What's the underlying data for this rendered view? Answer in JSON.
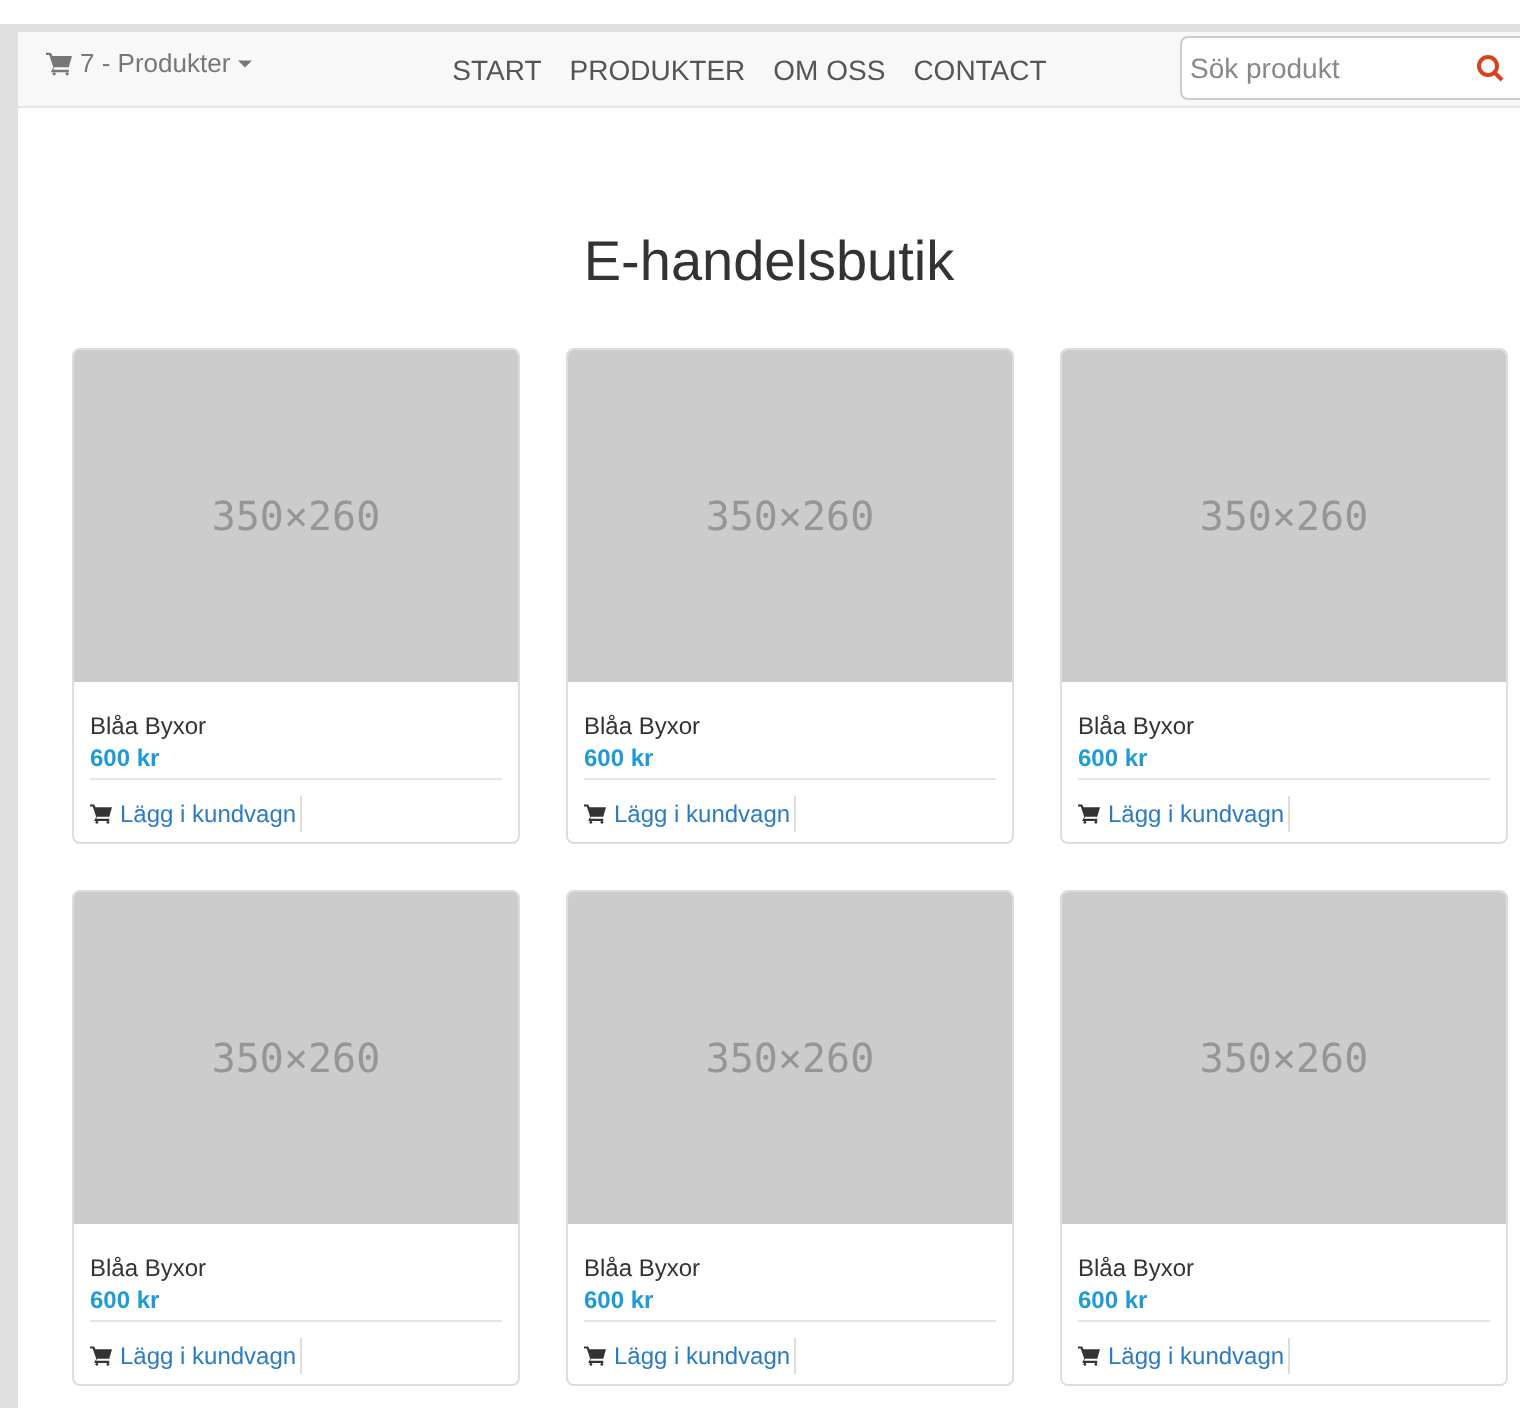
{
  "navbar": {
    "cart": "7 - Produkter",
    "links": [
      "START",
      "PRODUKTER",
      "OM OSS",
      "CONTACT"
    ],
    "search": {
      "placeholder": "Sök produkt"
    }
  },
  "heading": "E-handelsbutik",
  "products": [
    {
      "image": "350×260",
      "name": "Blåa Byxor",
      "price": "600 kr",
      "action": "Lägg i kundvagn"
    },
    {
      "image": "350×260",
      "name": "Blåa Byxor",
      "price": "600 kr",
      "action": "Lägg i kundvagn"
    },
    {
      "image": "350×260",
      "name": "Blåa Byxor",
      "price": "600 kr",
      "action": "Lägg i kundvagn"
    },
    {
      "image": "350×260",
      "name": "Blåa Byxor",
      "price": "600 kr",
      "action": "Lägg i kundvagn"
    },
    {
      "image": "350×260",
      "name": "Blåa Byxor",
      "price": "600 kr",
      "action": "Lägg i kundvagn"
    },
    {
      "image": "350×260",
      "name": "Blåa Byxor",
      "price": "600 kr",
      "action": "Lägg i kundvagn"
    }
  ]
}
